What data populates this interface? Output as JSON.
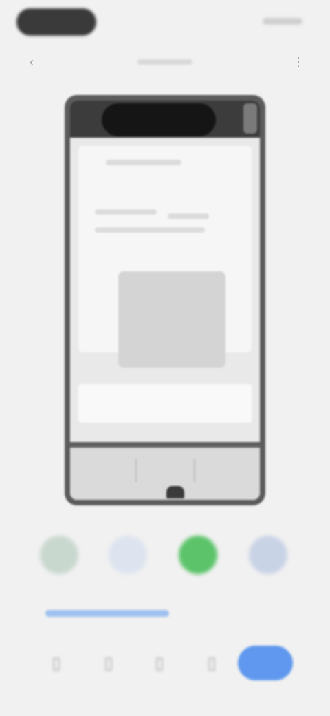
{
  "status": {
    "time": ""
  },
  "toolbar": {
    "title": "",
    "back_label": "‹",
    "menu_label": "⋮"
  },
  "preview": {},
  "share_targets": [
    {
      "name": "app-1",
      "label": "",
      "color": "#c9d8cf"
    },
    {
      "name": "app-2",
      "label": "",
      "color": "#dde3ef"
    },
    {
      "name": "app-3",
      "label": "",
      "color": "#5cc36a"
    },
    {
      "name": "app-4",
      "label": "",
      "color": "#c9d3e6"
    }
  ],
  "link_text": "",
  "bottom_actions": [
    {
      "name": "action-1",
      "glyph": "▯"
    },
    {
      "name": "action-2",
      "glyph": "▯"
    },
    {
      "name": "action-3",
      "glyph": "▯"
    },
    {
      "name": "action-4",
      "glyph": "▯"
    }
  ],
  "send_label": "",
  "colors": {
    "accent": "#5f98ee",
    "background": "#f1f1f1",
    "frame": "#5c5c5c"
  }
}
